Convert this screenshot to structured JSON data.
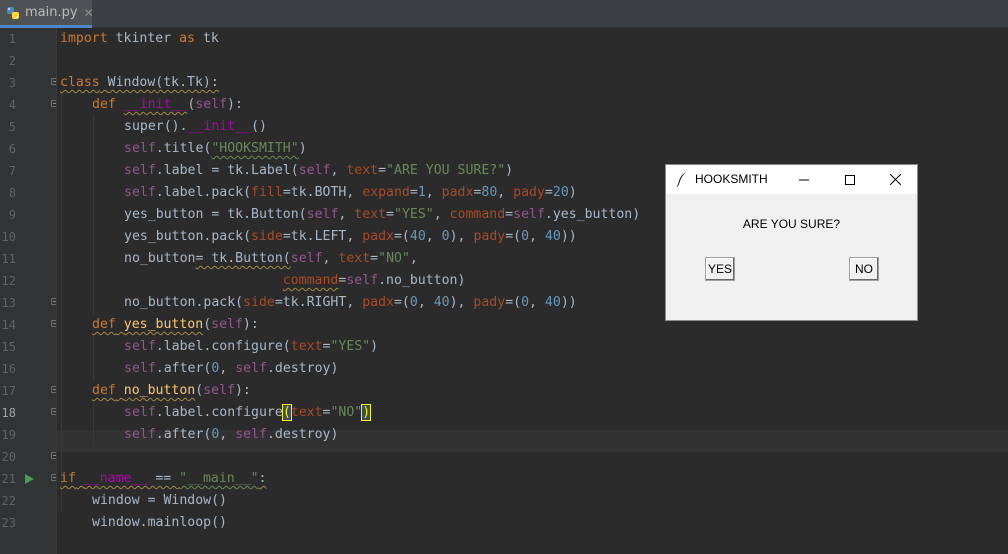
{
  "tab": {
    "filename": "main.py",
    "close_glyph": "✕"
  },
  "gutter": {
    "line_numbers": [
      "1",
      "2",
      "3",
      "4",
      "5",
      "6",
      "7",
      "8",
      "9",
      "10",
      "11",
      "12",
      "13",
      "14",
      "15",
      "16",
      "17",
      "18",
      "19",
      "20",
      "21",
      "22",
      "23"
    ]
  },
  "code": {
    "l1": {
      "kw": "import",
      "a": " tkinter ",
      "kw2": "as",
      "b": " tk"
    },
    "l3": {
      "kw": "class",
      "a": " ",
      "name": "Window",
      "b": "(tk.Tk):"
    },
    "l4": {
      "kw": "def",
      "sp": " ",
      "fn": "__init__",
      "a": "(",
      "self": "self",
      "b": "):"
    },
    "l5": {
      "a": "super().",
      "magic": "__init__",
      "b": "()"
    },
    "l6": {
      "self": "self",
      "a": ".title(",
      "str": "\"HOOKSMITH\"",
      "b": ")"
    },
    "l7": {
      "self": "self",
      "a": ".label = tk.Label(",
      "self2": "self",
      "b": ", ",
      "param": "text",
      "c": "=",
      "str": "\"ARE YOU SURE?\"",
      "d": ")"
    },
    "l8": {
      "self": "self",
      "a": ".label.pack(",
      "p1": "fill",
      "b": "=tk.BOTH, ",
      "p2": "expand",
      "c": "=",
      "n1": "1",
      "d": ", ",
      "p3": "padx",
      "e": "=",
      "n2": "80",
      "f": ", ",
      "p4": "pady",
      "g": "=",
      "n3": "20",
      "h": ")"
    },
    "l9": {
      "a": "yes_button = tk.Button(",
      "self": "self",
      "b": ", ",
      "p1": "text",
      "c": "=",
      "str": "\"YES\"",
      "d": ", ",
      "p2": "command",
      "e": "=",
      "self2": "self",
      "f": ".yes_button)"
    },
    "l10": {
      "a": "yes_button.pack(",
      "p1": "side",
      "b": "=tk.LEFT, ",
      "p2": "padx",
      "c": "=(",
      "n1": "40",
      "d": ", ",
      "n2": "0",
      "e": "), ",
      "p3": "pady",
      "f": "=(",
      "n3": "0",
      "g": ", ",
      "n4": "40",
      "h": "))"
    },
    "l11": {
      "a": "no_button",
      "b": "= tk.Button(",
      "self": "self",
      "c": ", ",
      "p1": "text",
      "d": "=",
      "str": "\"NO\"",
      "e": ","
    },
    "l12": {
      "pad": "                    ",
      "p1": "command",
      "a": "=",
      "self": "self",
      "b": ".no_button)"
    },
    "l13": {
      "a": "no_button.pack(",
      "p1": "side",
      "b": "=tk.RIGHT, ",
      "p2": "padx",
      "c": "=(",
      "n1": "0",
      "d": ", ",
      "n2": "40",
      "e": "), ",
      "p3": "pady",
      "f": "=(",
      "n3": "0",
      "g": ", ",
      "n4": "40",
      "h": "))"
    },
    "l14": {
      "kw": "def",
      "sp": " ",
      "fn": "yes_button",
      "a": "(",
      "self": "self",
      "b": "):"
    },
    "l15": {
      "self": "self",
      "a": ".label.configure(",
      "p1": "text",
      "b": "=",
      "str": "\"YES\"",
      "c": ")"
    },
    "l16": {
      "self": "self",
      "a": ".after(",
      "n1": "0",
      "b": ", ",
      "self2": "self",
      "c": ".destroy)"
    },
    "l17": {
      "kw": "def",
      "sp": " ",
      "fn": "no_button",
      "a": "(",
      "self": "self",
      "b": "):"
    },
    "l18": {
      "self": "self",
      "a": ".label.configure",
      "br1": "(",
      "p1": "text",
      "b": "=",
      "str": "\"NO\"",
      "br2": ")"
    },
    "l19": {
      "self": "self",
      "a": ".after(",
      "n1": "0",
      "b": ", ",
      "self2": "self",
      "c": ".destroy)"
    },
    "l21": {
      "kw": "if",
      "a": " ",
      "magic": "__name__",
      "b": " == ",
      "str": "\"__main__\"",
      "c": ":"
    },
    "l22": {
      "a": "window = Window()"
    },
    "l23": {
      "a": "window.mainloop()"
    }
  },
  "tk_window": {
    "title": "HOOKSMITH",
    "label": "ARE YOU SURE?",
    "yes_button": "YES",
    "no_button": "NO",
    "min_glyph": "—",
    "close_glyph": "✕"
  },
  "colors": {
    "keyword": "#cc7832",
    "string": "#6a8759",
    "number": "#6897bb",
    "self": "#94558d",
    "param": "#aa4926",
    "function": "#ffc66d",
    "magic": "#b200b2",
    "editor_bg": "#2b2b2b"
  }
}
